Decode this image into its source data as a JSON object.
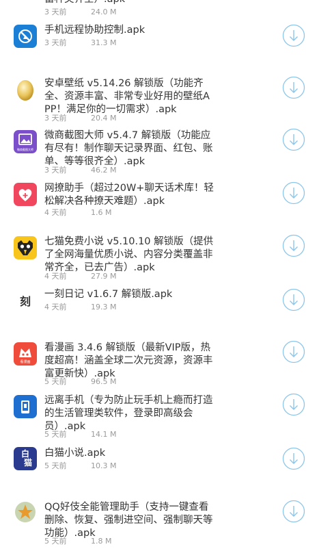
{
  "colors": {
    "title": "#333333",
    "meta": "#9a9a9a",
    "download": "#8cc6ea"
  },
  "partial_item": {
    "title_tail": "富种类齐全）.apk",
    "date": "3 天前",
    "size": "24.0 M"
  },
  "items": [
    {
      "title": "手机远程协助控制.apk",
      "date": "3 天前",
      "size": "31.3 M",
      "icon": "remote-control-icon"
    },
    {
      "title": "安卓壁纸 v5.14.26 解锁版（功能齐全、资源丰富、非常专业好用的壁纸APP！满足你的一切需求）.apk",
      "date": "3 天前",
      "size": "20.4 M",
      "icon": "golden-egg-icon"
    },
    {
      "title": "微商截图大师 v5.4.7 解锁版（功能应有尽有！制作聊天记录界面、红包、账单、等等很齐全）.apk",
      "date": "3 天前",
      "size": "46.2 M",
      "icon": "screenshot-picture-icon",
      "icon_caption": "微商截图大师"
    },
    {
      "title": "网撩助手（超过20W+聊天话术库！轻松解决各种撩天难题）.apk",
      "date": "4 天前",
      "size": "1.6 M",
      "icon": "heart-icon"
    },
    {
      "title": "七猫免费小说 v5.10.10 解锁版（提供了全网海量优质小说、内容分类覆盖非常齐全，已去广告）.apk",
      "date": "4 天前",
      "size": "27.9 M",
      "icon": "cat-face-icon"
    },
    {
      "title": "一刻日记 v1.6.7 解锁版.apk",
      "date": "4 天前",
      "size": "19.3 M",
      "icon": "yike-char-icon",
      "icon_glyph": "刻"
    },
    {
      "title": "看漫画 3.4.6 解锁版（最新VIP版，热度超高！涵盖全球二次元资源，资源丰富更新快）.apk",
      "date": "5 天前",
      "size": "96.5 M",
      "icon": "manga-icon",
      "icon_caption": "看漫画"
    },
    {
      "title": "远离手机（专为防止玩手机上瘾而打造的生活管理类软件，登录即高级会员）.apk",
      "date": "5 天前",
      "size": "14.1 M",
      "icon": "phone-lock-icon"
    },
    {
      "title": "白猫小说.apk",
      "date": "5 天前",
      "size": "10.3 M",
      "icon": "baimao-icon",
      "icon_glyph_top": "白",
      "icon_glyph_bottom": "猫"
    },
    {
      "title": "QQ好伎全能管理助手（支持一键查看删除、恢复、强制进空间、强制聊天等功能）.apk",
      "date": "5 天前",
      "size": "1.8 M",
      "icon": "star-badge-icon"
    }
  ]
}
